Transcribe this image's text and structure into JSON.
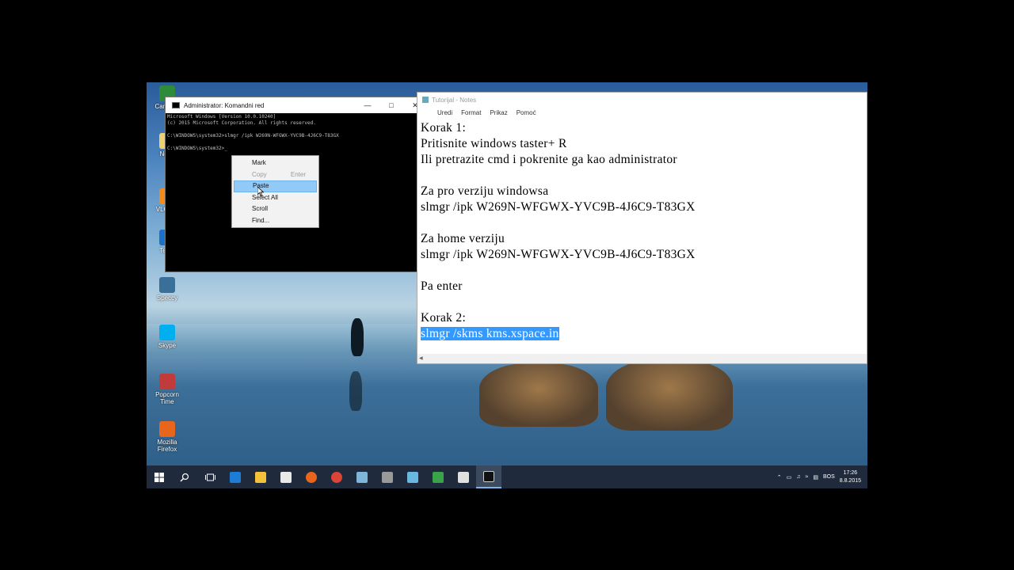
{
  "cmd": {
    "title": "Administrator: Komandni red",
    "lines": [
      "Microsoft Windows [Version 10.0.10240]",
      "(c) 2015 Microsoft Corporation. All rights reserved.",
      "",
      "C:\\WINDOWS\\system32>slmgr /ipk W269N-WFGWX-YVC9B-4J6C9-T83GX",
      "",
      "C:\\WINDOWS\\system32>_"
    ],
    "context_menu": [
      {
        "label": "Mark",
        "shortcut": "",
        "disabled": false
      },
      {
        "label": "Copy",
        "shortcut": "Enter",
        "disabled": true
      },
      {
        "label": "Paste",
        "shortcut": "",
        "disabled": false,
        "highlighted": true
      },
      {
        "label": "Select All",
        "shortcut": "",
        "disabled": false
      },
      {
        "label": "Scroll",
        "shortcut": "",
        "disabled": false
      },
      {
        "label": "Find...",
        "shortcut": "",
        "disabled": false
      }
    ]
  },
  "notes": {
    "title": "Tutorijal - Notes",
    "menu": [
      "Uredi",
      "Format",
      "Prikaz",
      "Pomoć"
    ],
    "lines": [
      "Korak 1:",
      "Pritisnite windows taster+ R",
      "Ili pretrazite cmd i pokrenite ga kao administrator",
      "",
      "Za pro verziju windowsa",
      "slmgr /ipk W269N-WFGWX-YVC9B-4J6C9-T83GX",
      "",
      "Za home verziju",
      "slmgr /ipk W269N-WFGWX-YVC9B-4J6C9-T83GX",
      "",
      "Pa enter",
      "",
      "Korak 2:"
    ],
    "selected_line": "slmgr /skms kms.xspace.in"
  },
  "desktop_icons": [
    {
      "label": "Cam Stu",
      "color": "#2e8b3a"
    },
    {
      "label": "Nova",
      "color": "#f0d070"
    },
    {
      "label": "VLC pla",
      "color": "#f28a1c"
    },
    {
      "label": "Team",
      "color": "#1a73c9"
    },
    {
      "label": "Speccy",
      "color": "#3a6f9a"
    },
    {
      "label": "Skype",
      "color": "#00aff0"
    },
    {
      "label": "Popcorn Time",
      "color": "#c23b3b"
    },
    {
      "label": "Mozilla Firefox",
      "color": "#e8661c"
    }
  ],
  "taskbar": {
    "apps": [
      {
        "name": "edge-icon",
        "color": "#1c7cd6"
      },
      {
        "name": "file-explorer-icon",
        "color": "#f3c13a"
      },
      {
        "name": "store-icon",
        "color": "#e8e8e8"
      },
      {
        "name": "firefox-icon",
        "color": "#e8661c"
      },
      {
        "name": "chrome-icon",
        "color": "#db4437"
      },
      {
        "name": "notes-app-icon",
        "color": "#7fb6d8"
      },
      {
        "name": "tools-icon",
        "color": "#9a9a9a"
      },
      {
        "name": "teamviewer-icon",
        "color": "#6ab8e0"
      },
      {
        "name": "camtasia-icon",
        "color": "#3aa34a"
      },
      {
        "name": "camstudio-icon",
        "color": "#e0e0e0"
      },
      {
        "name": "cmd-icon",
        "color": "#111111"
      }
    ],
    "language": "BOS",
    "time": "17:26",
    "date": "8.8.2015"
  }
}
